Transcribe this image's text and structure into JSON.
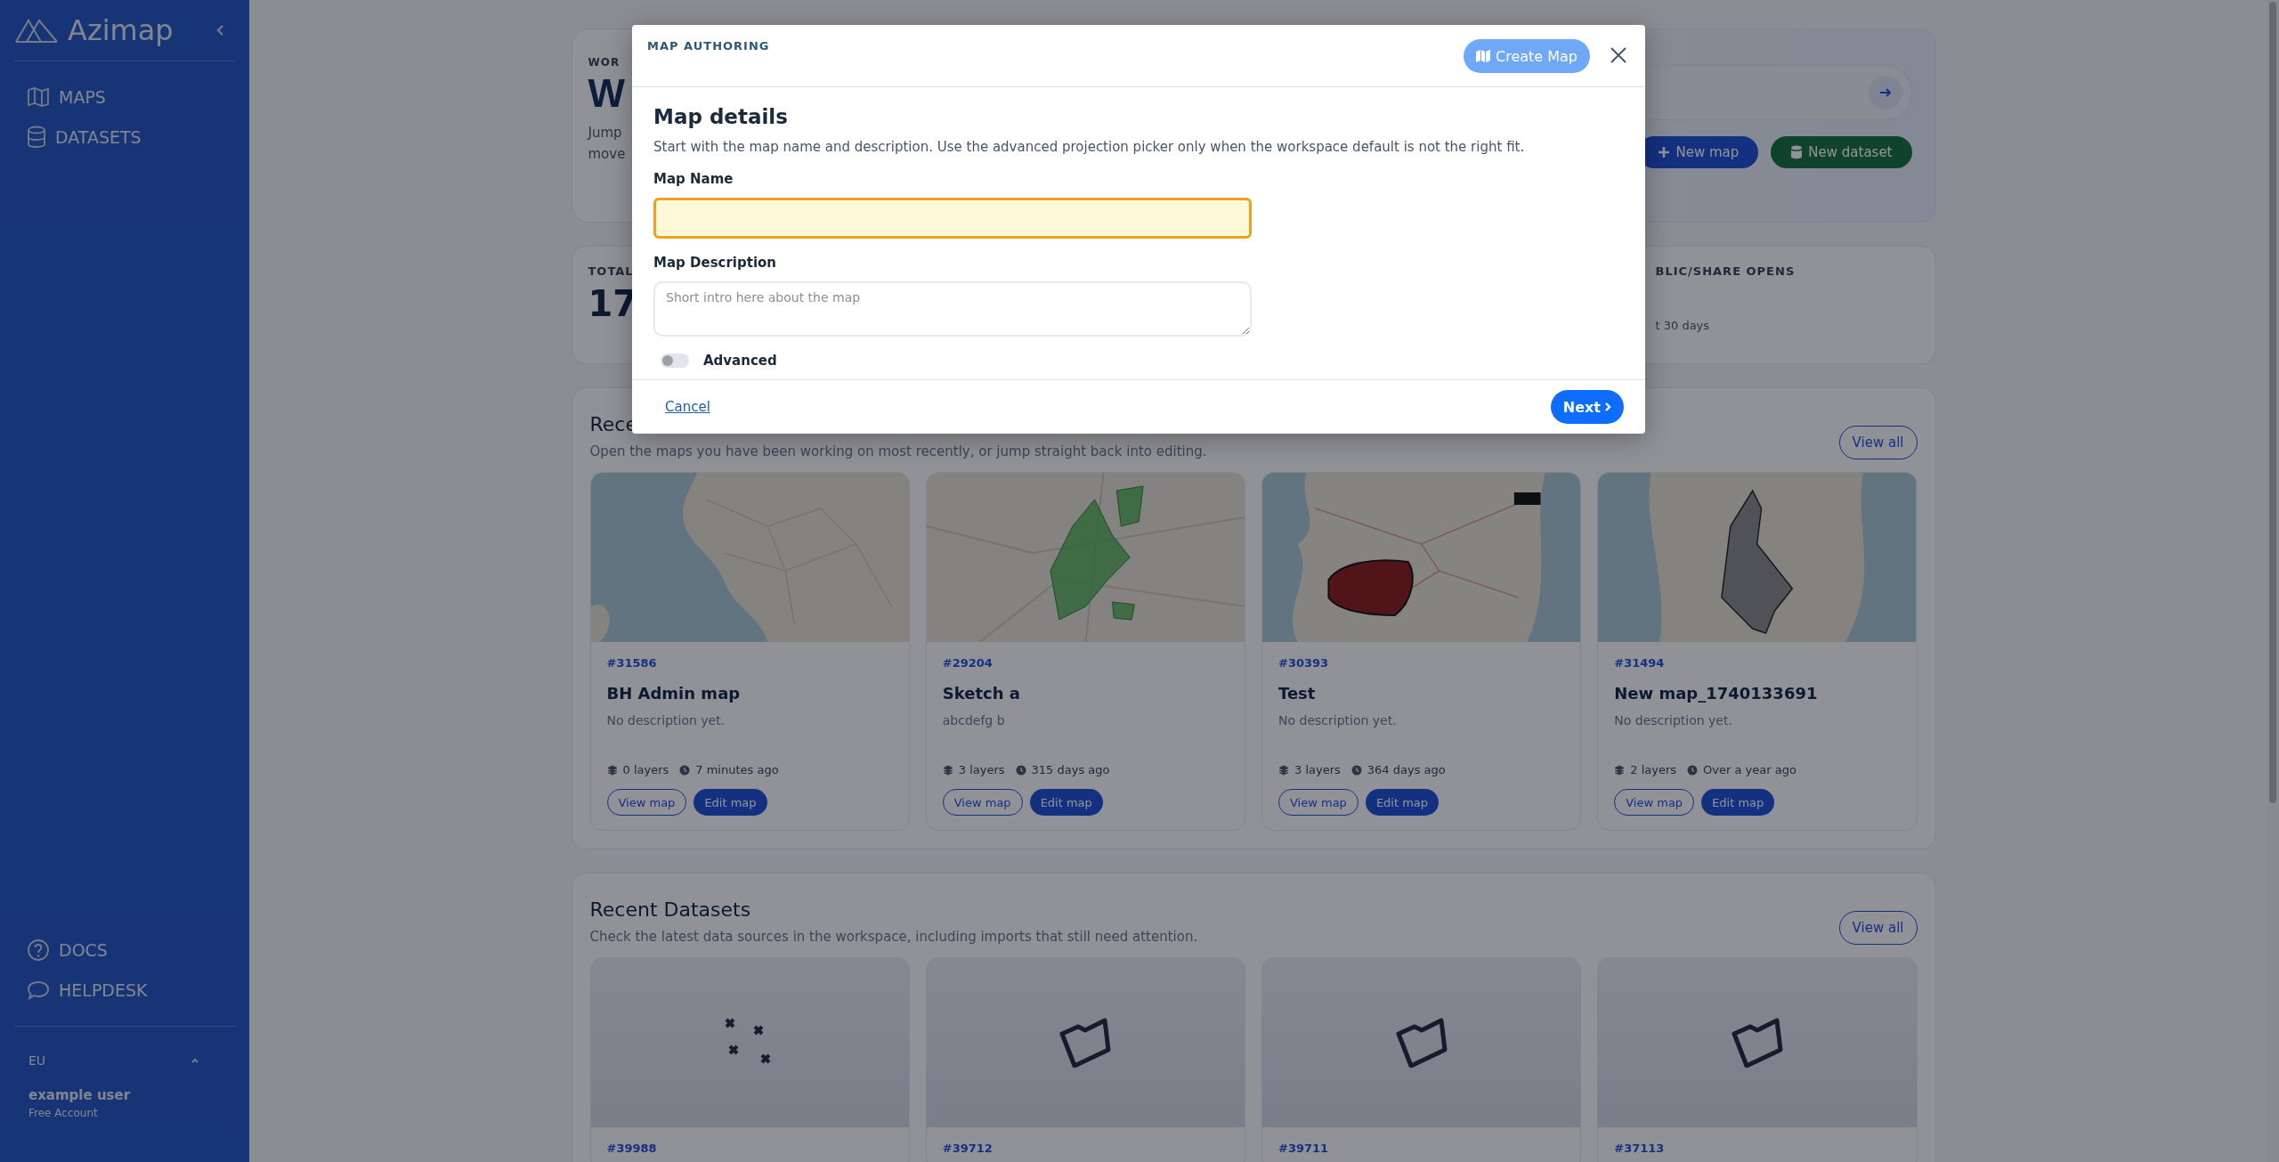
{
  "sidebar": {
    "brand": "Azimap",
    "nav": [
      {
        "label": "MAPS"
      },
      {
        "label": "DATASETS"
      }
    ],
    "footer_links": [
      {
        "label": "DOCS"
      },
      {
        "label": "HELPDESK"
      }
    ],
    "region": "EU",
    "user": {
      "name": "example user",
      "plan": "Free Account"
    }
  },
  "header": {
    "eyebrow": "WOR",
    "title": "W",
    "intro_lines": [
      "Jump",
      "move"
    ],
    "buttons": [
      {
        "kind": "primary",
        "label": "New map"
      },
      {
        "kind": "success",
        "label": "New dataset"
      }
    ]
  },
  "stats": {
    "first_label": "TOTAL",
    "first_value": "17",
    "last_label": "BLIC/SHARE OPENS",
    "last_note": "t 30 days"
  },
  "recent_maps": {
    "title": "Rece",
    "subtitle": "Open the maps you have been working on most recently, or jump straight back into editing.",
    "view_all": "View all",
    "cards": [
      {
        "id": "#31586",
        "title": "BH Admin map",
        "description": "No description yet.",
        "layers": "0 layers",
        "updated": "7 minutes ago",
        "view": "View map",
        "edit": "Edit map"
      },
      {
        "id": "#29204",
        "title": "Sketch a",
        "description": "abcdefg b",
        "layers": "3 layers",
        "updated": "315 days ago",
        "view": "View map",
        "edit": "Edit map"
      },
      {
        "id": "#30393",
        "title": "Test",
        "description": "No description yet.",
        "layers": "3 layers",
        "updated": "364 days ago",
        "view": "View map",
        "edit": "Edit map"
      },
      {
        "id": "#31494",
        "title": "New map_1740133691",
        "description": "No description yet.",
        "layers": "2 layers",
        "updated": "Over a year ago",
        "view": "View map",
        "edit": "Edit map"
      }
    ]
  },
  "recent_datasets": {
    "title": "Recent Datasets",
    "subtitle": "Check the latest data sources in the workspace, including imports that still need attention.",
    "view_all": "View all",
    "cards": [
      {
        "id": "#39988",
        "kind": "points"
      },
      {
        "id": "#39712",
        "kind": "polygon"
      },
      {
        "id": "#39711",
        "kind": "polygon"
      },
      {
        "id": "#37113",
        "kind": "polygon"
      }
    ]
  },
  "modal": {
    "eyebrow": "MAP AUTHORING",
    "create_button": "Create Map",
    "title": "Map details",
    "description": "Start with the map name and description. Use the advanced projection picker only when the workspace default is not the right fit.",
    "name_field": {
      "label": "Map Name",
      "focused": true
    },
    "description_field": {
      "label": "Map Description",
      "placeholder": "Short intro here about the map"
    },
    "advanced": {
      "label": "Advanced",
      "on": false
    },
    "cancel": "Cancel",
    "next": "Next"
  }
}
